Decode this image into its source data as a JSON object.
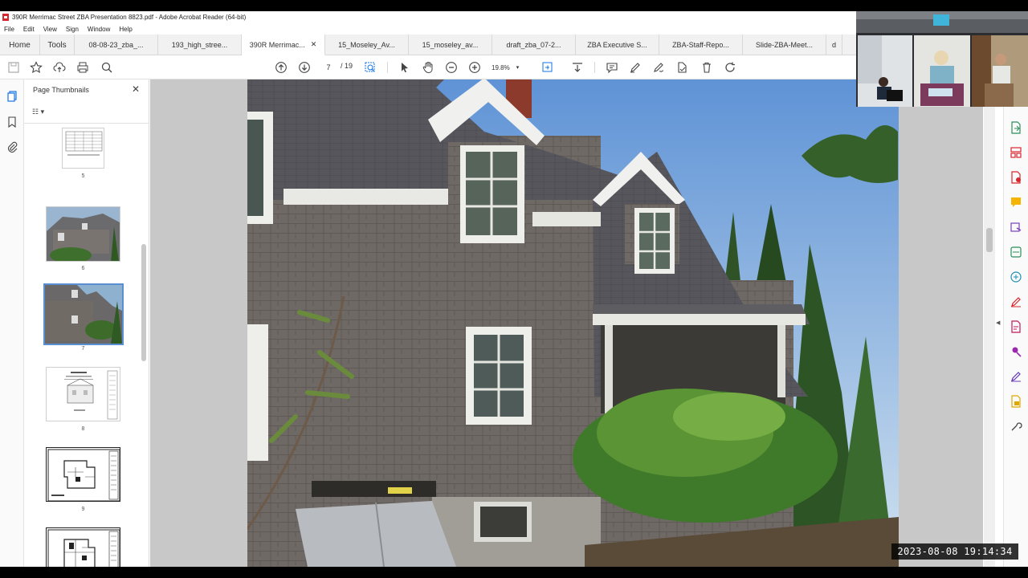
{
  "window": {
    "title": "390R Merrimac Street ZBA Presentation 8823.pdf - Adobe Acrobat Reader (64-bit)"
  },
  "menu": [
    "File",
    "Edit",
    "View",
    "Sign",
    "Window",
    "Help"
  ],
  "tabs": {
    "home": "Home",
    "tools": "Tools",
    "documents": [
      {
        "label": "08-08-23_zba_...",
        "active": false
      },
      {
        "label": "193_high_stree...",
        "active": false
      },
      {
        "label": "390R Merrimac...",
        "active": true
      },
      {
        "label": "15_Moseley_Av...",
        "active": false
      },
      {
        "label": "15_moseley_av...",
        "active": false
      },
      {
        "label": "draft_zba_07-2...",
        "active": false
      },
      {
        "label": "ZBA Executive S...",
        "active": false
      },
      {
        "label": "ZBA-Staff-Repo...",
        "active": false
      },
      {
        "label": "Slide-ZBA-Meet...",
        "active": false
      },
      {
        "label": "d",
        "active": false
      }
    ]
  },
  "toolbar": {
    "current_page": "7",
    "total_pages": "/ 19",
    "zoom": "19.8%"
  },
  "thumbnails_panel": {
    "title": "Page Thumbnails",
    "pages": [
      {
        "number": "5",
        "kind": "table",
        "selected": false
      },
      {
        "number": "6",
        "kind": "photo",
        "selected": false
      },
      {
        "number": "7",
        "kind": "photo",
        "selected": true
      },
      {
        "number": "8",
        "kind": "drawing",
        "selected": false
      },
      {
        "number": "9",
        "kind": "plan",
        "selected": false
      },
      {
        "number": "",
        "kind": "plan",
        "selected": false
      }
    ]
  },
  "overlay": {
    "timestamp": "2023-08-08  19:14:34"
  },
  "colors": {
    "accent": "#1473e6",
    "pdf_red": "#d8262c",
    "selected_thumb_border": "#5b8fd4"
  }
}
